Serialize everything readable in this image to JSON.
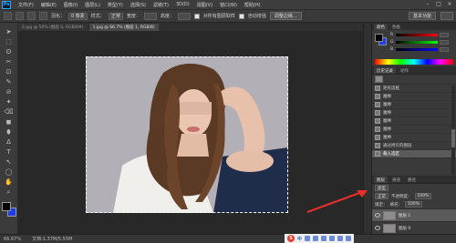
{
  "app": {
    "logo": "Ps",
    "menus": [
      "文件(F)",
      "编辑(E)",
      "图像(I)",
      "图层(L)",
      "类型(Y)",
      "选择(S)",
      "滤镜(T)",
      "3D(D)",
      "视图(V)",
      "窗口(W)",
      "帮助(H)"
    ],
    "window_controls": [
      "–",
      "□",
      "×"
    ]
  },
  "options_bar": {
    "feather_label": "羽化：",
    "feather_value": "0 像素",
    "style_label": "样式：",
    "style_value": "正常",
    "width_label": "宽度：",
    "height_label": "高度：",
    "sample_all_label": "对所有图层取样",
    "auto_enhance_label": "自动增强",
    "refine_edge_label": "调整边缘...",
    "workspace_label": "基本功能"
  },
  "doc_tabs": [
    "2.jpg @ 50% (图层 0, RGB/8#)",
    "1.jpg @ 66.7% (图层 1, RGB/8)"
  ],
  "tools": [
    "➤",
    "⬚",
    "ʘ",
    "✂",
    "⊡",
    "✎",
    "⊘",
    "✦",
    "⌫",
    "◼",
    "⬮",
    "∆",
    "T",
    "↖",
    "◯",
    "✋",
    "⌕"
  ],
  "colors": {
    "foreground": "#000000",
    "background": "#1b3cf0"
  },
  "panels": {
    "color_tabs": [
      "颜色",
      "色板"
    ],
    "history_tabs": [
      "历史记录",
      "动作"
    ],
    "layers_tabs": [
      "图层",
      "通道",
      "路径"
    ],
    "history_items": [
      {
        "label": "矩形选框",
        "active": false
      },
      {
        "label": "魔棒",
        "active": false
      },
      {
        "label": "魔棒",
        "active": false
      },
      {
        "label": "魔棒",
        "active": false
      },
      {
        "label": "魔棒",
        "active": false
      },
      {
        "label": "魔棒",
        "active": false
      },
      {
        "label": "魔棒",
        "active": false
      },
      {
        "label": "通过拷贝的图层",
        "active": false
      },
      {
        "label": "载入选区",
        "active": true
      }
    ],
    "layers_kind_label": "类型",
    "blend_mode": "正常",
    "opacity_label": "不透明度：",
    "opacity_value": "100%",
    "lock_label": "锁定：",
    "fill_label": "填充：",
    "fill_value": "100%",
    "layers": [
      {
        "name": "图层 1",
        "active": true
      },
      {
        "name": "图层 0",
        "active": false
      }
    ]
  },
  "status": {
    "zoom": "66.67%",
    "doc_info": "文档:1.37M/5.55M"
  },
  "ime": {
    "s_logo": "S",
    "lang": "中"
  }
}
